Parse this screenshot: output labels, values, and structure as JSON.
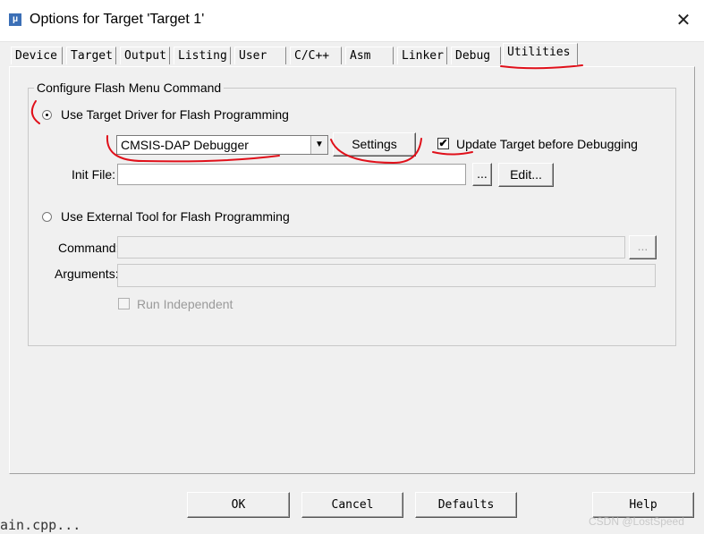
{
  "window": {
    "title": "Options for Target 'Target 1'",
    "app_icon_letter": "μ",
    "close_glyph": "✕"
  },
  "tabs": [
    {
      "label": "Device"
    },
    {
      "label": "Target"
    },
    {
      "label": "Output"
    },
    {
      "label": "Listing"
    },
    {
      "label": "User"
    },
    {
      "label": "C/C++"
    },
    {
      "label": "Asm"
    },
    {
      "label": "Linker"
    },
    {
      "label": "Debug"
    },
    {
      "label": "Utilities",
      "active": true
    }
  ],
  "flash": {
    "group_title": "Configure Flash Menu Command",
    "use_target_driver_label": "Use Target Driver for Flash Programming",
    "use_target_driver_selected": true,
    "driver_selected": "CMSIS-DAP Debugger",
    "settings_label": "Settings",
    "update_target_label": "Update Target before Debugging",
    "update_target_checked": true,
    "init_file_label": "Init File:",
    "init_file_value": "",
    "browse_label": "...",
    "edit_label": "Edit...",
    "use_external_tool_label": "Use External Tool for Flash Programming",
    "use_external_tool_selected": false,
    "command_label": "Command:",
    "command_value": "",
    "command_browse_label": "...",
    "arguments_label": "Arguments:",
    "arguments_value": "",
    "run_independent_label": "Run Independent",
    "run_independent_checked": false
  },
  "footer": {
    "ok_label": "OK",
    "cancel_label": "Cancel",
    "defaults_label": "Defaults",
    "help_label": "Help"
  },
  "background": {
    "partial_text": "ain.cpp..."
  },
  "watermark": "CSDN @LostSpeed",
  "colors": {
    "annotation_red": "#e0101a",
    "disabled_text": "#9a9a9a"
  }
}
